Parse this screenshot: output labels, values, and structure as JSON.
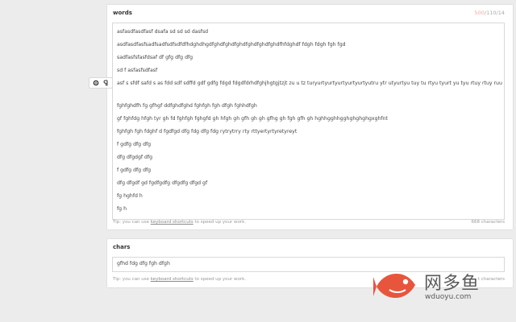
{
  "words": {
    "title": "words",
    "counter_used": "500",
    "counter_rest": "/110/14",
    "lines": [
      "asfasdfasdfasf dsafa sd sd sd dasfsd",
      "asdfasdfasfsadfsadfsdfsdfdfhdghdhgdfghdfghdfghdfghdfghdfghdfhfdghdf fdgh fdgh fgh fgd",
      "sadfasfsfasfdsaf df gfg dfg dfg",
      "sd f asfasfsdfasf",
      "asf s sfdf safd s as fdd sdf sdffd gdf gdfg fdgd fdgdfdrhdfghjhgtgjtzjt zu u tz turyurtyurtyurtyurtyurtyutru ytr utyurtyu tuy tu rtyu tyurt yu tyu rtuy rtuy ruu",
      "fghfghdfh fg gfhgf ddfghdfghd fghfgh fgh  dfgh fghhdfgh",
      "gf fghfdg hfgh tyr  gh fd fghfgh fghgfd gh   hfgh gh gfh gh gh gfhg gh fgh gfh gh    hghhgghhgghghghghgxghfnt",
      "fghfgh fgh fdghf d fgdfgd dfg fdg dfg fdg rytrytrry rty rttyertyrtyretyreyt",
      "f gdfg dfg dfg",
      "dfg dfgdgf dfg",
      "f gdfg dfg dfg",
      " dfg dfgdf gd fgdfgdfg dfgdfg dfgd gf",
      "fg hghfd h",
      "fg h"
    ],
    "tip_prefix": "Tip: you can use ",
    "tip_link": "keyboard shortcuts",
    "tip_suffix": " to speed up your work.",
    "char_count": "668 characters"
  },
  "chars": {
    "title": "chars",
    "value": "gfhd fdg dfg fgh dfgh",
    "tip_prefix": "Tip: you can use ",
    "tip_link": "keyboard shortcuts",
    "tip_suffix": " to speed up your work.",
    "char_count": "t characters"
  },
  "tools": {
    "settings_icon": "gear-icon",
    "format_icon": "pilcrow-icon"
  },
  "watermark": {
    "brand_text": "网多鱼",
    "url": "wduoyu.com",
    "accent_color": "#e8553d"
  }
}
